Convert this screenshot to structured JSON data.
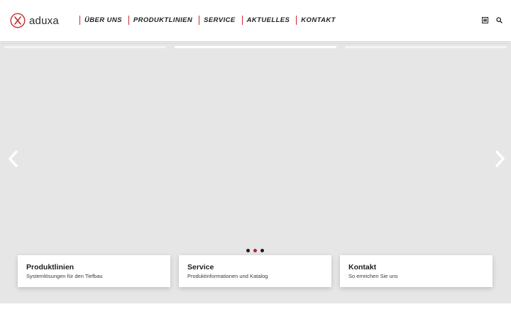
{
  "brand": {
    "name": "aduxa",
    "accent": "#c8282d"
  },
  "nav": {
    "items": [
      {
        "label": "ÜBER UNS"
      },
      {
        "label": "PRODUKTLINIEN"
      },
      {
        "label": "SERVICE"
      },
      {
        "label": "AKTUELLES"
      },
      {
        "label": "KONTAKT"
      }
    ]
  },
  "tools": {
    "icons": [
      "grid-icon",
      "search-icon"
    ]
  },
  "slider": {
    "slide_count": 3,
    "active_slide": 2,
    "background": "#e6e6e6",
    "dot_active_color": "#b3242a"
  },
  "cards": [
    {
      "title": "Produktlinien",
      "subtitle": "Systemlösungen für den Tiefbau"
    },
    {
      "title": "Service",
      "subtitle": "Produktinformationen und Katalog"
    },
    {
      "title": "Kontakt",
      "subtitle": "So erreichen Sie uns"
    }
  ]
}
